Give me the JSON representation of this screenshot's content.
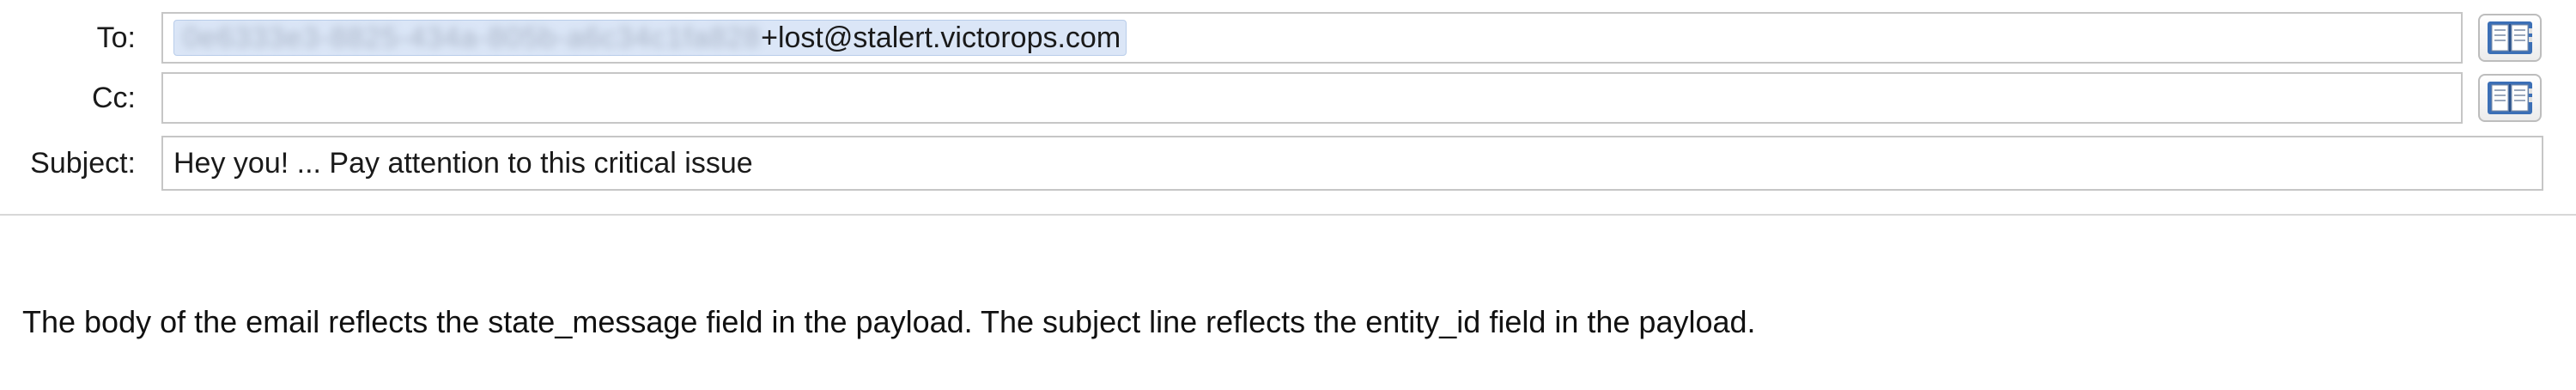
{
  "header": {
    "to": {
      "label": "To:",
      "recipient_redacted": "0e6333e3-8825-434a-805b-a6c34c1fa828",
      "recipient_address": "+lost@stalert.victorops.com"
    },
    "cc": {
      "label": "Cc:",
      "value": ""
    },
    "subject": {
      "label": "Subject:",
      "value": "Hey you! ... Pay attention to this critical issue"
    },
    "address_book_icon": "address-book-icon"
  },
  "body": {
    "text": "The body of the email reflects the state_message field in the payload. The subject line reflects the entity_id field in the payload."
  },
  "colors": {
    "token_background": "#dbe6f7",
    "field_border": "#c6c6c6",
    "book_cover": "#3b6fb6"
  }
}
